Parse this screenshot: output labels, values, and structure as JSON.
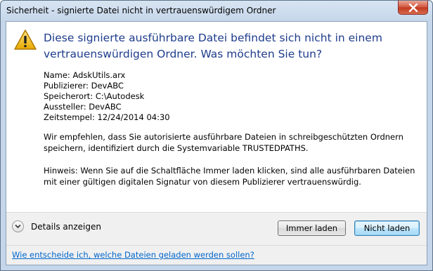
{
  "window": {
    "title": "Sicherheit - signierte Datei nicht in vertrauenswürdigem Ordner"
  },
  "icons": {
    "warning": "warning-triangle-icon",
    "close": "close-icon",
    "expand": "chevron-down-icon"
  },
  "heading": "Diese signierte ausführbare Datei befindet sich nicht in einem vertrauenswürdigen Ordner. Was möchten Sie tun?",
  "file_info": {
    "name": "Name: AdskUtils.arx",
    "publisher": "Publizierer: DevABC",
    "location": "Speicherort: C:\\Autodesk",
    "issuer": "Aussteller: DevABC",
    "timestamp": "Zeitstempel: 12/24/2014 04:30"
  },
  "recommendation": "Wir empfehlen, dass Sie autorisierte ausführbare Dateien in schreibgeschützten Ordnern speichern, identifiziert durch die Systemvariable TRUSTEDPATHS.",
  "hint": "Hinweis: Wenn Sie auf die Schaltfläche Immer laden klicken, sind alle ausführbaren Dateien mit einer gültigen digitalen Signatur von diesem Publizierer vertrauenswürdig.",
  "details_label": "Details anzeigen",
  "buttons": {
    "always_load": "Immer laden",
    "dont_load": "Nicht laden"
  },
  "footer_link": "Wie entscheide ich, welche Dateien geladen werden sollen?",
  "colors": {
    "heading": "#1e3c8c",
    "link": "#0066cc",
    "warning": "#f0c000"
  }
}
